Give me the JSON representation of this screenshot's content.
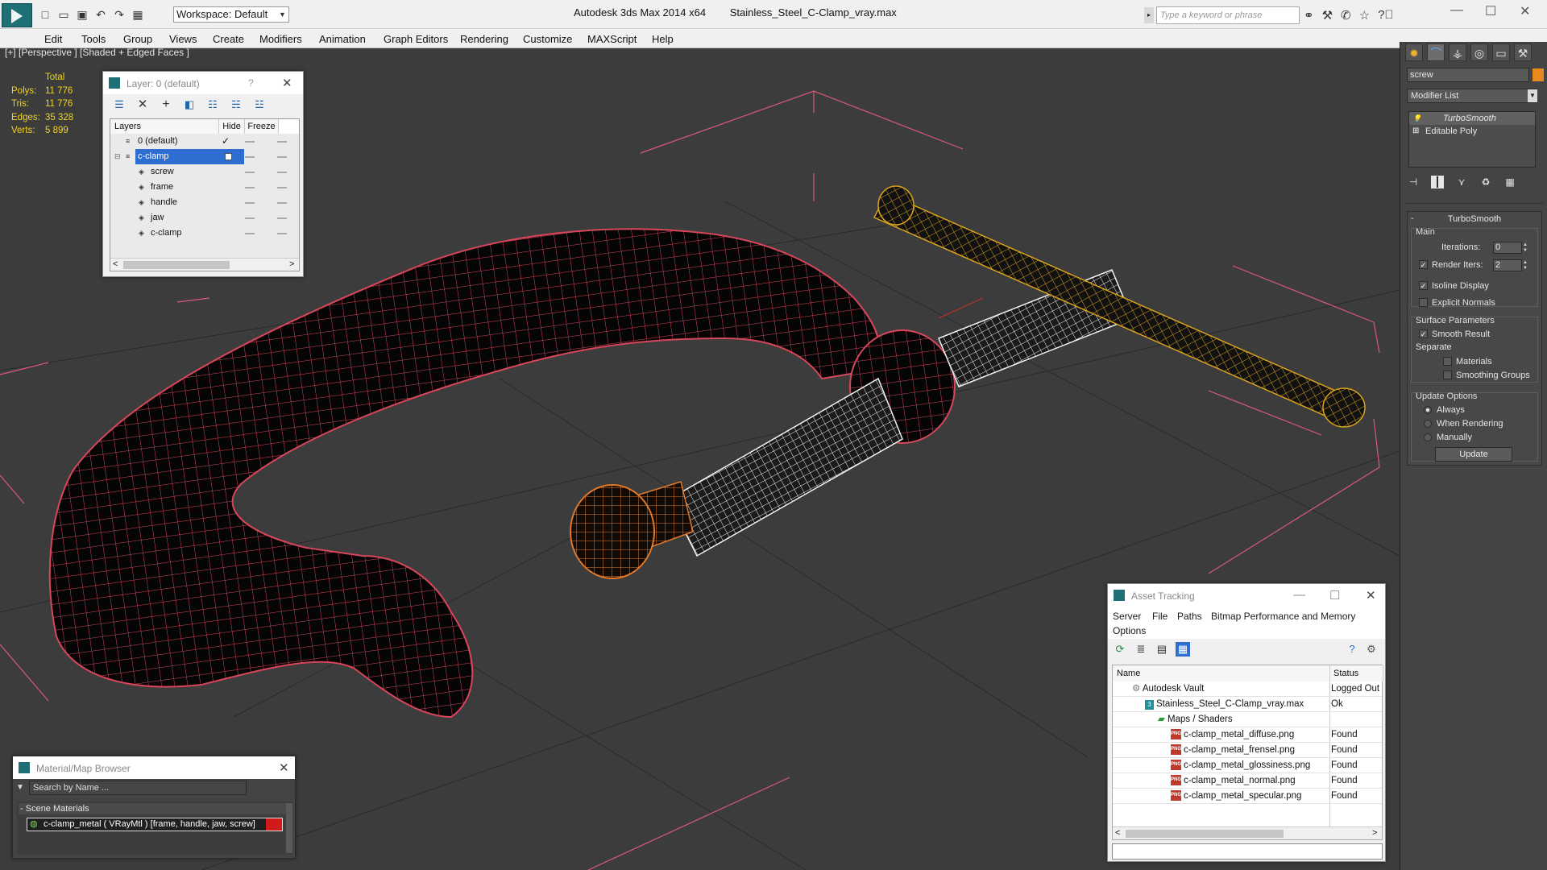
{
  "titlebar": {
    "workspace": "Workspace: Default",
    "app": "Autodesk 3ds Max  2014 x64",
    "file": "Stainless_Steel_C-Clamp_vray.max",
    "search_placeholder": "Type a keyword or phrase"
  },
  "menu": [
    "Edit",
    "Tools",
    "Group",
    "Views",
    "Create",
    "Modifiers",
    "Animation",
    "Graph Editors",
    "Rendering",
    "Customize",
    "MAXScript",
    "Help"
  ],
  "viewport": {
    "label": "[+] [Perspective ] [Shaded + Edged Faces ]",
    "stats": {
      "header": "Total",
      "rows": [
        {
          "label": "Polys:",
          "value": "11 776"
        },
        {
          "label": "Tris:",
          "value": "11 776"
        },
        {
          "label": "Edges:",
          "value": "35 328"
        },
        {
          "label": "Verts:",
          "value": "5 899"
        }
      ]
    }
  },
  "layer_window": {
    "title": "Layer: 0 (default)",
    "help": "?",
    "columns": {
      "layers": "Layers",
      "hide": "Hide",
      "freeze": "Freeze"
    },
    "rows": [
      {
        "name": "0 (default)",
        "indent": 1
      },
      {
        "name": "c-clamp",
        "indent": 1
      },
      {
        "name": "screw",
        "indent": 2
      },
      {
        "name": "frame",
        "indent": 2
      },
      {
        "name": "handle",
        "indent": 2
      },
      {
        "name": "jaw",
        "indent": 2
      },
      {
        "name": "c-clamp",
        "indent": 2
      }
    ],
    "scroll_left": "<",
    "scroll_right": ">"
  },
  "command_panel": {
    "object_name": "screw",
    "object_color": "#e8891e",
    "modifier_list": "Modifier List",
    "stack": [
      "TurboSmooth",
      "Editable Poly"
    ],
    "rollout": {
      "title": "TurboSmooth",
      "main_label": "Main",
      "iterations_label": "Iterations:",
      "iterations_value": "0",
      "render_iters_label": "Render Iters:",
      "render_iters_value": "2",
      "isoline": "Isoline Display",
      "explicit_normals": "Explicit Normals",
      "surface_params": "Surface Parameters",
      "smooth_result": "Smooth Result",
      "separate": "Separate",
      "materials": "Materials",
      "smoothing_groups": "Smoothing Groups",
      "update_options": "Update Options",
      "always": "Always",
      "when_rendering": "When Rendering",
      "manually": "Manually",
      "update_button": "Update"
    }
  },
  "asset_tracking": {
    "title": "Asset Tracking",
    "menu": [
      "Server",
      "File",
      "Paths",
      "Bitmap Performance and Memory",
      "Options"
    ],
    "columns": {
      "name": "Name",
      "status": "Status"
    },
    "rows": [
      {
        "name": "Autodesk Vault",
        "status": "Logged Out",
        "indent": 0,
        "icon": "vault"
      },
      {
        "name": "Stainless_Steel_C-Clamp_vray.max",
        "status": "Ok",
        "indent": 1,
        "icon": "max"
      },
      {
        "name": "Maps / Shaders",
        "status": "",
        "indent": 2,
        "icon": "maps"
      },
      {
        "name": "c-clamp_metal_diffuse.png",
        "status": "Found",
        "indent": 3,
        "icon": "png"
      },
      {
        "name": "c-clamp_metal_frensel.png",
        "status": "Found",
        "indent": 3,
        "icon": "png"
      },
      {
        "name": "c-clamp_metal_glossiness.png",
        "status": "Found",
        "indent": 3,
        "icon": "png"
      },
      {
        "name": "c-clamp_metal_normal.png",
        "status": "Found",
        "indent": 3,
        "icon": "png"
      },
      {
        "name": "c-clamp_metal_specular.png",
        "status": "Found",
        "indent": 3,
        "icon": "png"
      }
    ],
    "scroll_left": "<",
    "scroll_right": ">"
  },
  "material_browser": {
    "title": "Material/Map Browser",
    "search_placeholder": "Search by Name ...",
    "section": "Scene Materials",
    "material": "c-clamp_metal  ( VRayMtl )  [frame, handle, jaw, screw]"
  },
  "colors": {
    "wire_red": "#d8465b",
    "wire_white": "#f2f2f2",
    "wire_yellow": "#d9a21e",
    "wire_orange": "#e0792a",
    "bbox_pink": "#d95a7a"
  }
}
